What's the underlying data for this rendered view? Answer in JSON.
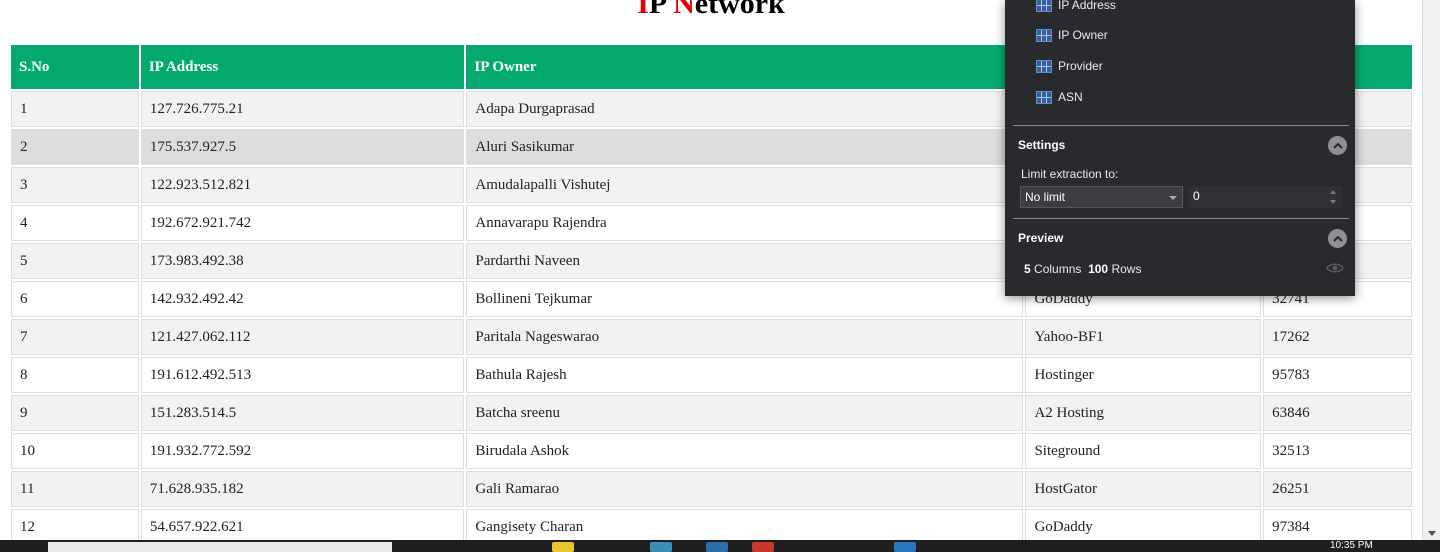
{
  "page": {
    "title_first_letter_1": "I",
    "title_part_1": "P",
    "title_first_letter_2": "N",
    "title_part_2": "etwork"
  },
  "table": {
    "headers": [
      "S.No",
      "IP Address",
      "IP Owner",
      "",
      ""
    ],
    "rows": [
      {
        "sno": "1",
        "ip": "127.726.775.21",
        "owner": "Adapa Durgaprasad",
        "provider": "",
        "asn": ""
      },
      {
        "sno": "2",
        "ip": "175.537.927.5",
        "owner": "Aluri Sasikumar",
        "provider": "",
        "asn": ""
      },
      {
        "sno": "3",
        "ip": "122.923.512.821",
        "owner": "Amudalapalli Vishutej",
        "provider": "",
        "asn": ""
      },
      {
        "sno": "4",
        "ip": "192.672.921.742",
        "owner": "Annavarapu Rajendra",
        "provider": "",
        "asn": ""
      },
      {
        "sno": "5",
        "ip": "173.983.492.38",
        "owner": "Pardarthi Naveen",
        "provider": "",
        "asn": ""
      },
      {
        "sno": "6",
        "ip": "142.932.492.42",
        "owner": "Bollineni Tejkumar",
        "provider": "GoDaddy",
        "asn": "32741"
      },
      {
        "sno": "7",
        "ip": "121.427.062.112",
        "owner": "Paritala Nageswarao",
        "provider": "Yahoo-BF1",
        "asn": "17262"
      },
      {
        "sno": "8",
        "ip": "191.612.492.513",
        "owner": "Bathula Rajesh",
        "provider": "Hostinger",
        "asn": "95783"
      },
      {
        "sno": "9",
        "ip": "151.283.514.5",
        "owner": "Batcha sreenu",
        "provider": "A2 Hosting",
        "asn": "63846"
      },
      {
        "sno": "10",
        "ip": "191.932.772.592",
        "owner": "Birudala Ashok",
        "provider": "Siteground",
        "asn": "32513"
      },
      {
        "sno": "11",
        "ip": "71.628.935.182",
        "owner": "Gali Ramarao",
        "provider": "HostGator",
        "asn": "26251"
      },
      {
        "sno": "12",
        "ip": "54.657.922.621",
        "owner": "Gangisety Charan",
        "provider": "GoDaddy",
        "asn": "97384"
      }
    ]
  },
  "popup": {
    "columns": [
      "IP Address",
      "IP Owner",
      "Provider",
      "ASN"
    ],
    "settings_title": "Settings",
    "limit_label": "Limit extraction to:",
    "limit_select_value": "No limit",
    "limit_number_value": "0",
    "preview_title": "Preview",
    "preview_columns_count": "5",
    "preview_columns_label": "Columns",
    "preview_rows_count": "100",
    "preview_rows_label": "Rows"
  },
  "taskbar": {
    "clock": "10:35 PM"
  },
  "colors": {
    "header_green": "#04aa6d",
    "title_red": "#e00000",
    "popup_bg": "#292a2d"
  }
}
